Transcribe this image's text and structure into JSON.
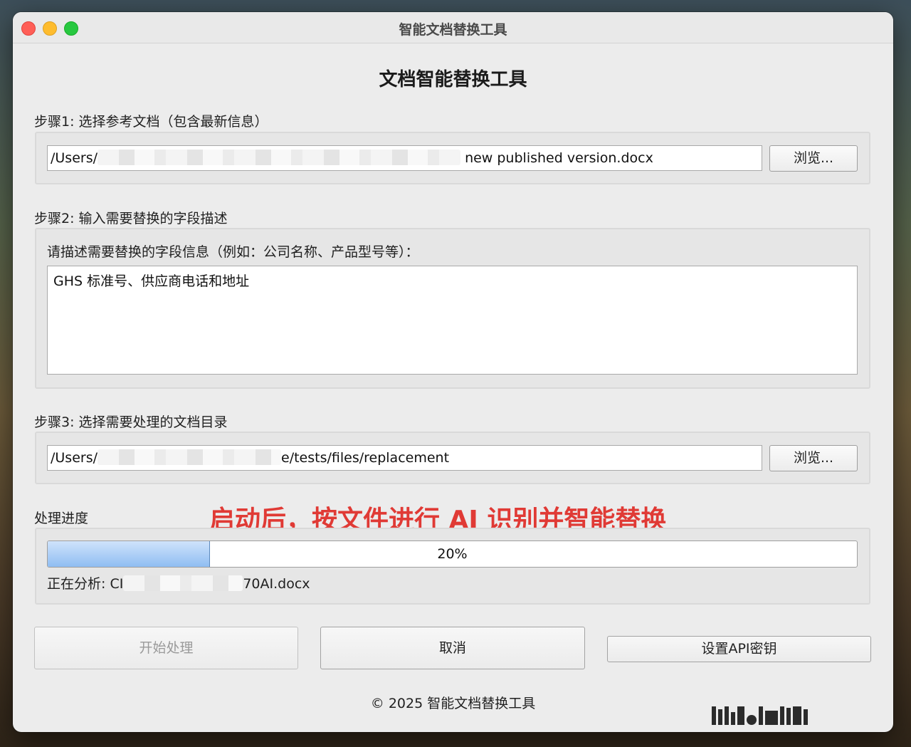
{
  "window": {
    "title": "智能文档替换工具"
  },
  "heading": "文档智能替换工具",
  "step1": {
    "label": "步骤1: 选择参考文档（包含最新信息）",
    "path_prefix": "/Users/",
    "path_suffix": "new published version.docx",
    "browse_label": "浏览..."
  },
  "step2": {
    "label": "步骤2: 输入需要替换的字段描述",
    "prompt": "请描述需要替换的字段信息（例如：公司名称、产品型号等）：",
    "value": "GHS 标准号、供应商电话和地址"
  },
  "step3": {
    "label": "步骤3: 选择需要处理的文档目录",
    "path_prefix": "/Users/",
    "path_suffix": "e/tests/files/replacement",
    "browse_label": "浏览..."
  },
  "progress": {
    "label": "处理进度",
    "percent": 20,
    "percent_text": "20%",
    "status_prefix": "正在分析: CI",
    "status_suffix": "70AI.docx"
  },
  "annotation": "启动后，按文件进行 AI 识别并智能替换",
  "buttons": {
    "start": "开始处理",
    "cancel": "取消",
    "api_key": "设置API密钥"
  },
  "footer": "© 2025 智能文档替换工具",
  "colors": {
    "annotation": "#e03a35",
    "progress_fill": "#8fbdf2",
    "close": "#ff5f57",
    "minimize": "#febc2e",
    "maximize": "#28c840"
  }
}
